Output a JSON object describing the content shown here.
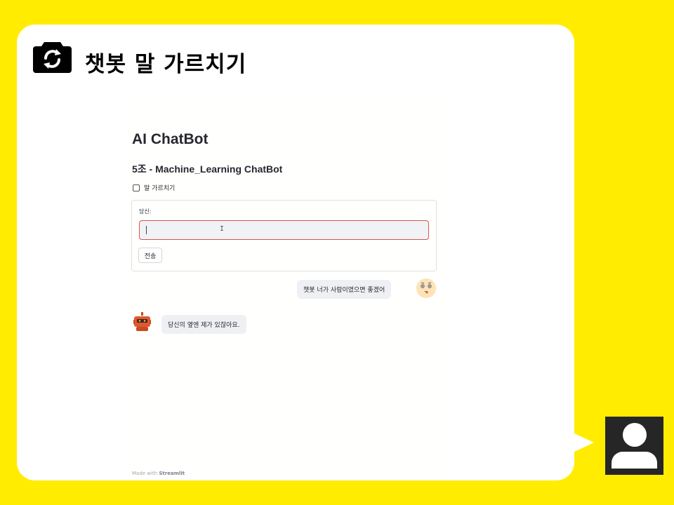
{
  "header": {
    "title": "챗봇 말 가르치기",
    "icon": "camera-refresh-icon"
  },
  "app": {
    "title": "AI ChatBot",
    "subtitle": "5조 - Machine_Learning ChatBot",
    "teach_checkbox_label": "말 가르치기",
    "teach_checkbox_checked": false,
    "form": {
      "input_label": "당신:",
      "input_value": "",
      "send_button": "전송"
    },
    "messages": [
      {
        "role": "user",
        "text": "챗봇 너가 사람이였으면 좋겠어",
        "avatar": "smiley-face-icon"
      },
      {
        "role": "bot",
        "text": "당신의 옆엔 제가 있잖아요.",
        "avatar": "robot-icon"
      }
    ],
    "footer_made_with": "Made with",
    "footer_brand": "Streamlit"
  },
  "presenter": {
    "avatar": "person-silhouette-icon"
  },
  "colors": {
    "background": "#ffec00",
    "card": "#ffffff",
    "input_border": "#d9534f",
    "bubble": "#eef0f3"
  }
}
